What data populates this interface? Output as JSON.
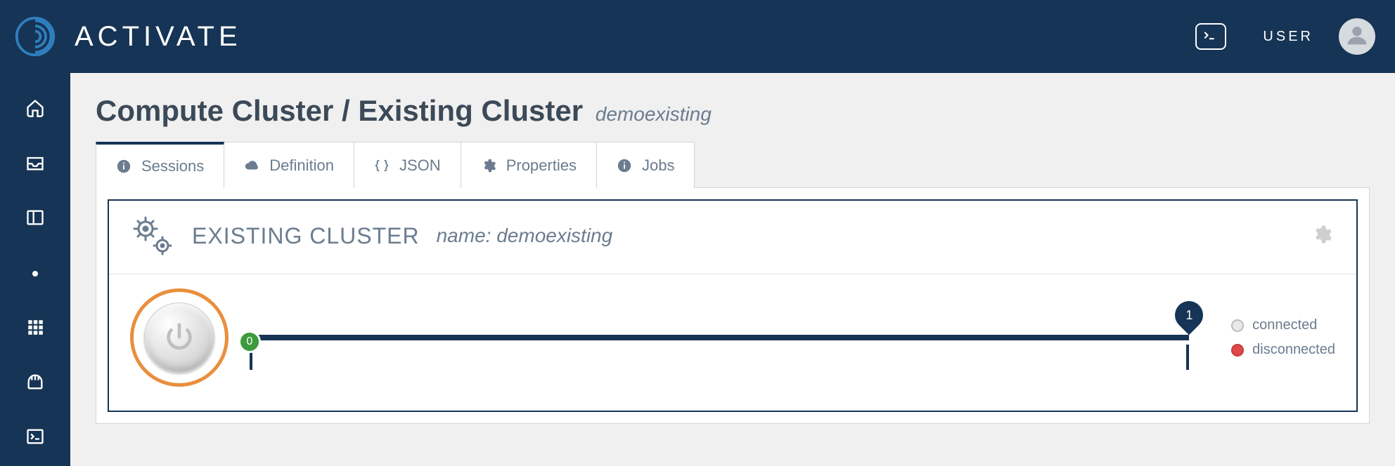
{
  "brand": "ACTIVATE",
  "header": {
    "user_label": "USER"
  },
  "page": {
    "breadcrumb_main": "Compute Cluster / Existing Cluster",
    "breadcrumb_sub": "demoexisting"
  },
  "tabs": [
    {
      "id": "sessions",
      "label": "Sessions",
      "icon": "info",
      "active": true
    },
    {
      "id": "definition",
      "label": "Definition",
      "icon": "cloud",
      "active": false
    },
    {
      "id": "json",
      "label": "JSON",
      "icon": "braces",
      "active": false
    },
    {
      "id": "properties",
      "label": "Properties",
      "icon": "gear",
      "active": false
    },
    {
      "id": "jobs",
      "label": "Jobs",
      "icon": "info",
      "active": false
    }
  ],
  "panel": {
    "title": "EXISTING CLUSTER",
    "name_label": "name:",
    "name_value": "demoexisting",
    "slider": {
      "min": 0,
      "max": 1,
      "current": 0
    },
    "legend": {
      "connected": "connected",
      "disconnected": "disconnected"
    }
  }
}
